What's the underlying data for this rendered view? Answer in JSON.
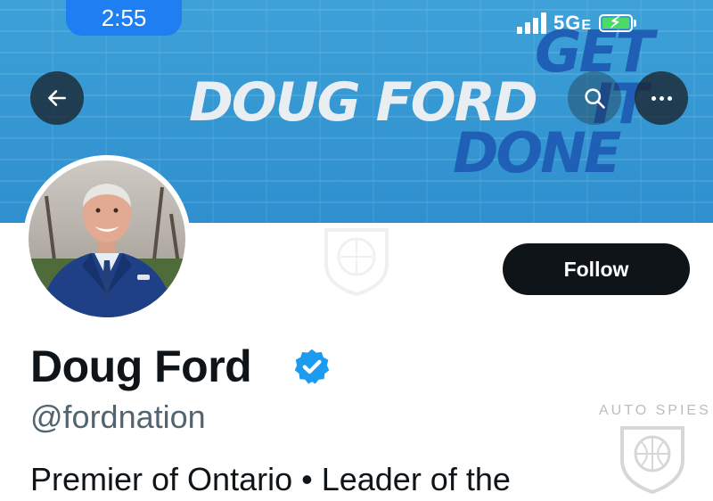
{
  "status_bar": {
    "time": "2:55",
    "network": "5G",
    "network_suffix": "E"
  },
  "banner": {
    "name_text": "DOUG FORD",
    "slogan_get": "GET",
    "slogan_it": "IT",
    "slogan_done": "DONE"
  },
  "header_actions": {
    "back_icon": "arrow-left",
    "search_icon": "magnifier",
    "more_icon": "ellipsis"
  },
  "profile": {
    "display_name": "Doug Ford",
    "handle": "@fordnation",
    "bio": "Premier of Ontario • Leader of the",
    "follow_label": "Follow",
    "verified_color": "#1d9bf0"
  },
  "watermark": {
    "text": "AUTO SPIES"
  },
  "colors": {
    "banner_blue": "#3597d2",
    "slogan_blue": "#1f5fb5",
    "follow_bg": "#0f1419",
    "handle_gray": "#536471"
  }
}
